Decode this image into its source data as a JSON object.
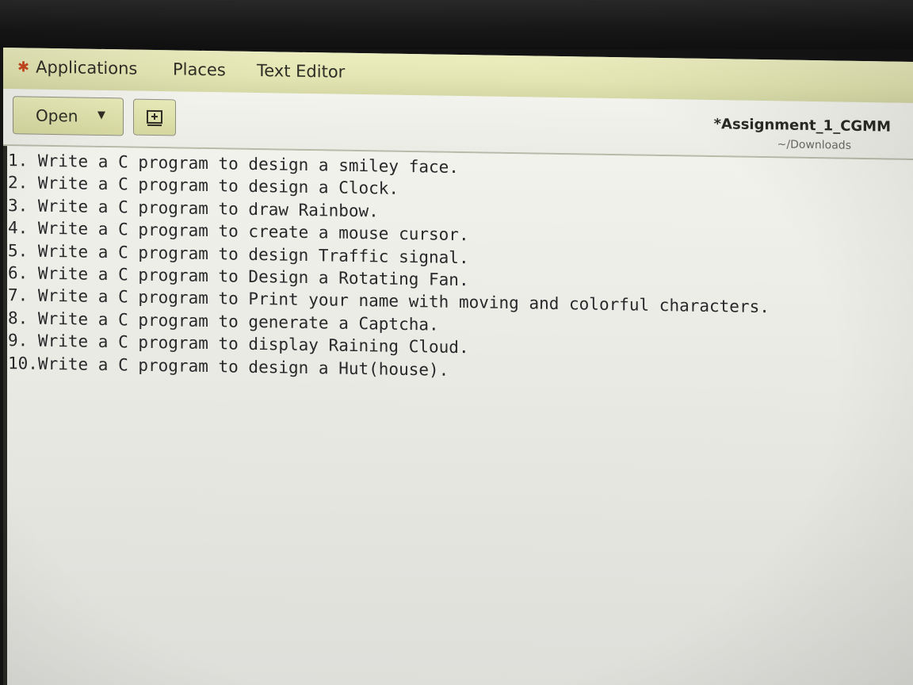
{
  "topbar": {
    "applications_label": "Applications",
    "places_label": "Places",
    "app_label": "Text Editor"
  },
  "toolbar": {
    "open_label": "Open",
    "doc_title": "*Assignment_1_CGMM",
    "doc_path": "~/Downloads"
  },
  "editor": {
    "lines": [
      "1. Write a C program to design a smiley face.",
      "2. Write a C program to design a Clock.",
      "3. Write a C program to draw Rainbow.",
      "4. Write a C program to create a mouse cursor.",
      "5. Write a C program to design Traffic signal.",
      "6. Write a C program to Design a Rotating Fan.",
      "7. Write a C program to Print your name with moving and colorful characters.",
      "8. Write a C program to generate a Captcha.",
      "9. Write a C program to display Raining Cloud.",
      "10.Write a C program to design a Hut(house)."
    ]
  },
  "icons": {
    "applications": "gnome-foot-icon",
    "open_dropdown": "chevron-down-icon",
    "new_document": "new-document-icon"
  },
  "colors": {
    "topbar": "#e3e5b2",
    "editor_background": "#f2f2ec",
    "text": "#28282a",
    "accent": "#c8491f"
  }
}
